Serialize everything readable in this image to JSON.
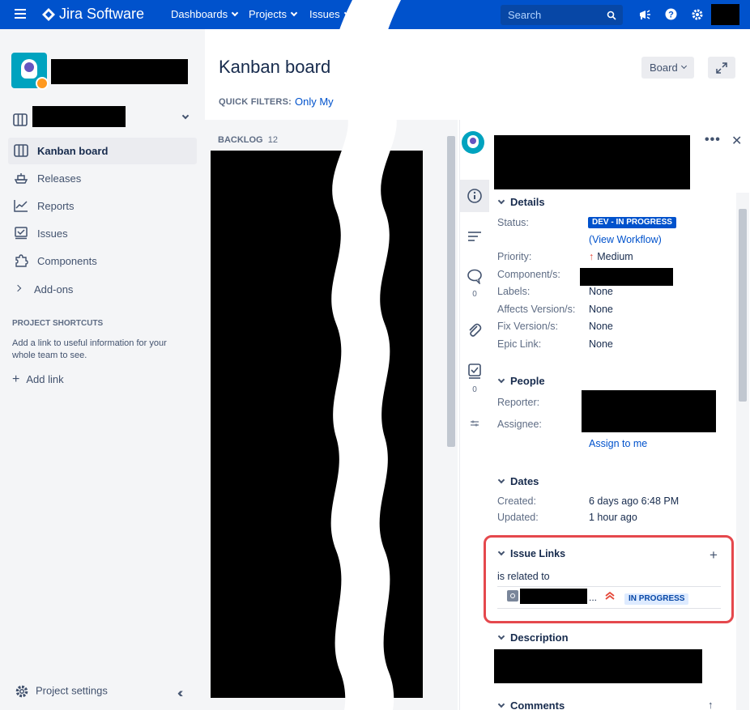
{
  "topnav": {
    "app_name": "Jira Software",
    "menus": [
      "Dashboards",
      "Projects",
      "Issues"
    ],
    "search_placeholder": "Search"
  },
  "sidebar": {
    "items": [
      {
        "label": "Kanban board",
        "icon": "board-icon"
      },
      {
        "label": "Releases",
        "icon": "ship-icon"
      },
      {
        "label": "Reports",
        "icon": "chart-icon"
      },
      {
        "label": "Issues",
        "icon": "issues-icon"
      },
      {
        "label": "Components",
        "icon": "puzzle-icon"
      },
      {
        "label": "Add-ons",
        "icon": "chevron-right-icon"
      }
    ],
    "shortcuts_title": "PROJECT SHORTCUTS",
    "shortcuts_desc": "Add a link to useful information for your whole team to see.",
    "add_link": "Add link",
    "project_settings": "Project settings"
  },
  "board": {
    "title": "Kanban board",
    "board_button": "Board",
    "quick_filters_label": "QUICK FILTERS:",
    "quick_filter": "Only My",
    "column_label": "BACKLOG",
    "column_count": "12"
  },
  "detail": {
    "comment_count": "0",
    "checklist_count": "0",
    "sections": {
      "details": "Details",
      "people": "People",
      "dates": "Dates",
      "issue_links": "Issue Links",
      "description": "Description",
      "comments": "Comments"
    },
    "details": {
      "status_label": "Status:",
      "status_value": "DEV - IN PROGRESS",
      "view_workflow": "(View Workflow)",
      "priority_label": "Priority:",
      "priority_value": "Medium",
      "component_label": "Component/s:",
      "labels_label": "Labels:",
      "labels_value": "None",
      "affects_label": "Affects Version/s:",
      "affects_value": "None",
      "fix_label": "Fix Version/s:",
      "fix_value": "None",
      "epic_label": "Epic Link:",
      "epic_value": "None"
    },
    "people": {
      "reporter_label": "Reporter:",
      "assignee_label": "Assignee:",
      "assign_to_me": "Assign to me"
    },
    "dates": {
      "created_label": "Created:",
      "created_value": "6 days ago 6:48 PM",
      "updated_label": "Updated:",
      "updated_value": "1 hour ago"
    },
    "issue_links": {
      "relation": "is related to",
      "ellipsis": "...",
      "linked_status": "IN PROGRESS"
    }
  },
  "colors": {
    "nav_bg": "#0052cc",
    "sidebar_bg": "#f4f5f7",
    "highlight_border": "#e5484d",
    "priority": "#e5493a"
  }
}
